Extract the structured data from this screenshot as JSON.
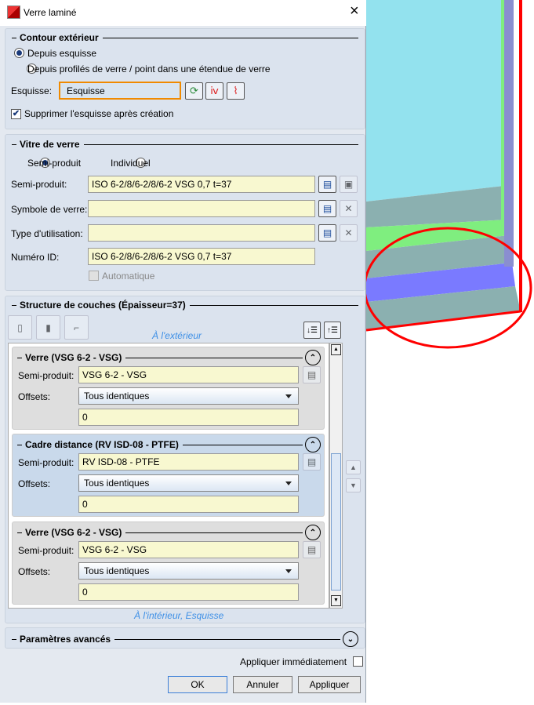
{
  "window": {
    "title": "Verre laminé",
    "close": "×"
  },
  "contour": {
    "title": "Contour extérieur",
    "radio1": "Depuis esquisse",
    "radio2": "Depuis profilés de verre / point dans une étendue de verre",
    "sketch_label": "Esquisse:",
    "sketch_value": "Esquisse",
    "delete_sketch": "Supprimer l'esquisse après création",
    "delete_checked": true
  },
  "vitre": {
    "title": "Vitre de verre",
    "radio1": "Semi-produit",
    "radio2": "Individuel",
    "semi_label": "Semi-produit:",
    "semi_value": "ISO 6-2/8/6-2/8/6-2 VSG 0,7 t=37",
    "symbol_label": "Symbole de verre:",
    "symbol_value": "",
    "type_label": "Type d'utilisation:",
    "type_value": "",
    "id_label": "Numéro ID:",
    "id_value": "ISO 6-2/8/6-2/8/6-2 VSG 0,7 t=37",
    "auto_label": "Automatique"
  },
  "structure": {
    "title": "Structure de couches (Épaisseur=37)",
    "outside": "À l'extérieur",
    "inside": "À l'intérieur, Esquisse",
    "layers": [
      {
        "title": "Verre (VSG 6-2 - VSG)",
        "semi_label": "Semi-produit:",
        "semi_value": "VSG 6-2 - VSG",
        "offsets_label": "Offsets:",
        "offsets_value": "Tous identiques",
        "offset": "0"
      },
      {
        "title": "Cadre distance (RV ISD-08 - PTFE)",
        "semi_label": "Semi-produit:",
        "semi_value": "RV ISD-08 - PTFE",
        "offsets_label": "Offsets:",
        "offsets_value": "Tous identiques",
        "offset": "0"
      },
      {
        "title": "Verre (VSG 6-2 - VSG)",
        "semi_label": "Semi-produit:",
        "semi_value": "VSG 6-2 - VSG",
        "offsets_label": "Offsets:",
        "offsets_value": "Tous identiques",
        "offset": "0"
      }
    ]
  },
  "advanced": {
    "title": "Paramètres avancés"
  },
  "footer": {
    "apply_now": "Appliquer immédiatement",
    "ok": "OK",
    "cancel": "Annuler",
    "apply": "Appliquer"
  }
}
